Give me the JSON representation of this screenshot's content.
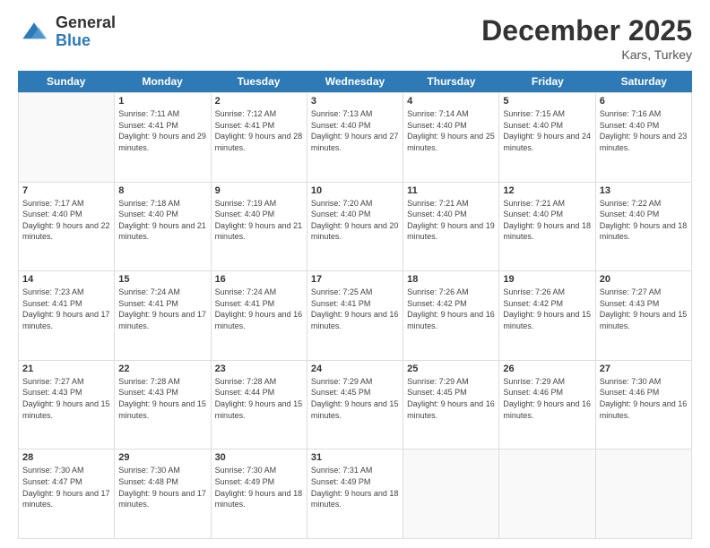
{
  "header": {
    "logo_general": "General",
    "logo_blue": "Blue",
    "title": "December 2025",
    "location": "Kars, Turkey"
  },
  "days_of_week": [
    "Sunday",
    "Monday",
    "Tuesday",
    "Wednesday",
    "Thursday",
    "Friday",
    "Saturday"
  ],
  "weeks": [
    [
      {
        "day": "",
        "sunrise": "",
        "sunset": "",
        "daylight": "",
        "empty": true
      },
      {
        "day": "1",
        "sunrise": "7:11 AM",
        "sunset": "4:41 PM",
        "daylight": "9 hours and 29 minutes."
      },
      {
        "day": "2",
        "sunrise": "7:12 AM",
        "sunset": "4:41 PM",
        "daylight": "9 hours and 28 minutes."
      },
      {
        "day": "3",
        "sunrise": "7:13 AM",
        "sunset": "4:40 PM",
        "daylight": "9 hours and 27 minutes."
      },
      {
        "day": "4",
        "sunrise": "7:14 AM",
        "sunset": "4:40 PM",
        "daylight": "9 hours and 25 minutes."
      },
      {
        "day": "5",
        "sunrise": "7:15 AM",
        "sunset": "4:40 PM",
        "daylight": "9 hours and 24 minutes."
      },
      {
        "day": "6",
        "sunrise": "7:16 AM",
        "sunset": "4:40 PM",
        "daylight": "9 hours and 23 minutes."
      }
    ],
    [
      {
        "day": "7",
        "sunrise": "7:17 AM",
        "sunset": "4:40 PM",
        "daylight": "9 hours and 22 minutes."
      },
      {
        "day": "8",
        "sunrise": "7:18 AM",
        "sunset": "4:40 PM",
        "daylight": "9 hours and 21 minutes."
      },
      {
        "day": "9",
        "sunrise": "7:19 AM",
        "sunset": "4:40 PM",
        "daylight": "9 hours and 21 minutes."
      },
      {
        "day": "10",
        "sunrise": "7:20 AM",
        "sunset": "4:40 PM",
        "daylight": "9 hours and 20 minutes."
      },
      {
        "day": "11",
        "sunrise": "7:21 AM",
        "sunset": "4:40 PM",
        "daylight": "9 hours and 19 minutes."
      },
      {
        "day": "12",
        "sunrise": "7:21 AM",
        "sunset": "4:40 PM",
        "daylight": "9 hours and 18 minutes."
      },
      {
        "day": "13",
        "sunrise": "7:22 AM",
        "sunset": "4:40 PM",
        "daylight": "9 hours and 18 minutes."
      }
    ],
    [
      {
        "day": "14",
        "sunrise": "7:23 AM",
        "sunset": "4:41 PM",
        "daylight": "9 hours and 17 minutes."
      },
      {
        "day": "15",
        "sunrise": "7:24 AM",
        "sunset": "4:41 PM",
        "daylight": "9 hours and 17 minutes."
      },
      {
        "day": "16",
        "sunrise": "7:24 AM",
        "sunset": "4:41 PM",
        "daylight": "9 hours and 16 minutes."
      },
      {
        "day": "17",
        "sunrise": "7:25 AM",
        "sunset": "4:41 PM",
        "daylight": "9 hours and 16 minutes."
      },
      {
        "day": "18",
        "sunrise": "7:26 AM",
        "sunset": "4:42 PM",
        "daylight": "9 hours and 16 minutes."
      },
      {
        "day": "19",
        "sunrise": "7:26 AM",
        "sunset": "4:42 PM",
        "daylight": "9 hours and 15 minutes."
      },
      {
        "day": "20",
        "sunrise": "7:27 AM",
        "sunset": "4:43 PM",
        "daylight": "9 hours and 15 minutes."
      }
    ],
    [
      {
        "day": "21",
        "sunrise": "7:27 AM",
        "sunset": "4:43 PM",
        "daylight": "9 hours and 15 minutes."
      },
      {
        "day": "22",
        "sunrise": "7:28 AM",
        "sunset": "4:43 PM",
        "daylight": "9 hours and 15 minutes."
      },
      {
        "day": "23",
        "sunrise": "7:28 AM",
        "sunset": "4:44 PM",
        "daylight": "9 hours and 15 minutes."
      },
      {
        "day": "24",
        "sunrise": "7:29 AM",
        "sunset": "4:45 PM",
        "daylight": "9 hours and 15 minutes."
      },
      {
        "day": "25",
        "sunrise": "7:29 AM",
        "sunset": "4:45 PM",
        "daylight": "9 hours and 16 minutes."
      },
      {
        "day": "26",
        "sunrise": "7:29 AM",
        "sunset": "4:46 PM",
        "daylight": "9 hours and 16 minutes."
      },
      {
        "day": "27",
        "sunrise": "7:30 AM",
        "sunset": "4:46 PM",
        "daylight": "9 hours and 16 minutes."
      }
    ],
    [
      {
        "day": "28",
        "sunrise": "7:30 AM",
        "sunset": "4:47 PM",
        "daylight": "9 hours and 17 minutes."
      },
      {
        "day": "29",
        "sunrise": "7:30 AM",
        "sunset": "4:48 PM",
        "daylight": "9 hours and 17 minutes."
      },
      {
        "day": "30",
        "sunrise": "7:30 AM",
        "sunset": "4:49 PM",
        "daylight": "9 hours and 18 minutes."
      },
      {
        "day": "31",
        "sunrise": "7:31 AM",
        "sunset": "4:49 PM",
        "daylight": "9 hours and 18 minutes."
      },
      {
        "day": "",
        "sunrise": "",
        "sunset": "",
        "daylight": "",
        "empty": true
      },
      {
        "day": "",
        "sunrise": "",
        "sunset": "",
        "daylight": "",
        "empty": true
      },
      {
        "day": "",
        "sunrise": "",
        "sunset": "",
        "daylight": "",
        "empty": true
      }
    ]
  ]
}
